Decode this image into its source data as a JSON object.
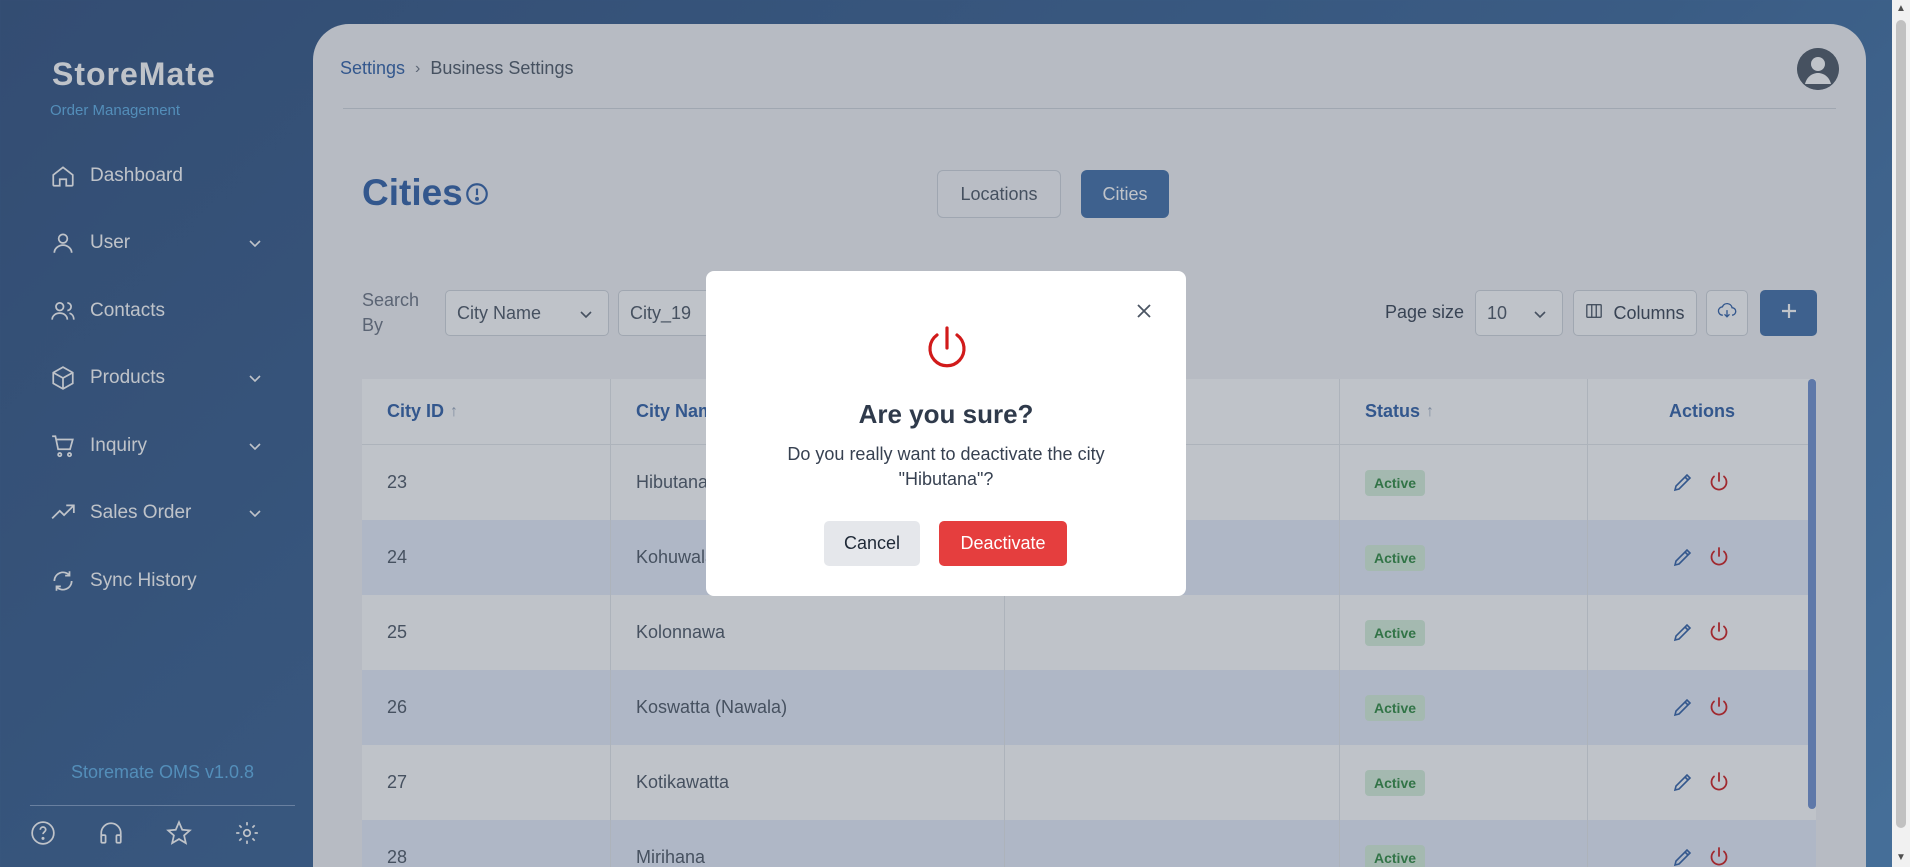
{
  "sidebar": {
    "logo": "StoreMate",
    "logo_sub": "Order Management",
    "items": [
      {
        "label": "Dashboard",
        "icon": "home-icon",
        "expandable": false
      },
      {
        "label": "User",
        "icon": "user-icon",
        "expandable": true
      },
      {
        "label": "Contacts",
        "icon": "contacts-icon",
        "expandable": false
      },
      {
        "label": "Products",
        "icon": "box-icon",
        "expandable": true
      },
      {
        "label": "Inquiry",
        "icon": "cart-icon",
        "expandable": true
      },
      {
        "label": "Sales Order",
        "icon": "trending-icon",
        "expandable": true
      },
      {
        "label": "Sync History",
        "icon": "sync-icon",
        "expandable": false
      }
    ],
    "version": "Storemate OMS v1.0.8",
    "bottom_icons": [
      "help-icon",
      "headset-icon",
      "star-icon",
      "gear-icon"
    ]
  },
  "header": {
    "breadcrumb": [
      "Settings",
      "Business Settings"
    ]
  },
  "page": {
    "title": "Cities",
    "tabs": [
      {
        "label": "Locations",
        "active": false
      },
      {
        "label": "Cities",
        "active": true
      }
    ]
  },
  "toolbar": {
    "search_by_label": "Search By",
    "search_field": "City Name",
    "search_value": "City_19",
    "page_size_label": "Page size",
    "page_size": "10",
    "columns_label": "Columns"
  },
  "table": {
    "columns": [
      "City ID",
      "City Name",
      "",
      "Status",
      "Actions"
    ],
    "rows": [
      {
        "id": "23",
        "name": "Hibutana",
        "status": "Active"
      },
      {
        "id": "24",
        "name": "Kohuwala",
        "status": "Active"
      },
      {
        "id": "25",
        "name": "Kolonnawa",
        "status": "Active"
      },
      {
        "id": "26",
        "name": "Koswatta (Nawala)",
        "status": "Active"
      },
      {
        "id": "27",
        "name": "Kotikawatta",
        "status": "Active"
      },
      {
        "id": "28",
        "name": "Mirihana",
        "status": "Active"
      }
    ]
  },
  "modal": {
    "title": "Are you sure?",
    "message": "Do you really want to deactivate the city \"Hibutana\"?",
    "cancel_label": "Cancel",
    "confirm_label": "Deactivate"
  },
  "colors": {
    "brand": "#3f6ea8",
    "danger": "#e53e3e",
    "active_badge": "#d7f0da"
  }
}
